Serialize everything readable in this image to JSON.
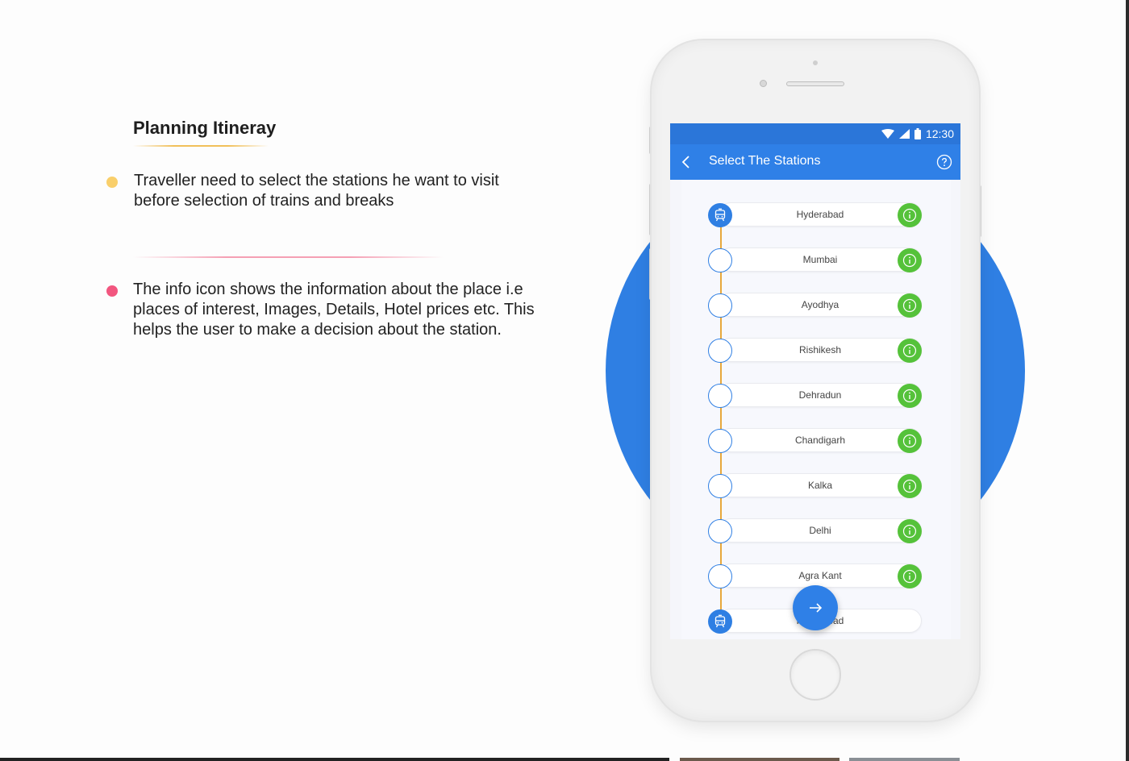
{
  "section": {
    "title": "Planning Itineray",
    "bullets": [
      {
        "text": "Traveller need to select the stations he want to visit before selection of trains and breaks",
        "color": "#f9cf6b"
      },
      {
        "text": "The info icon shows the information about the place i.e places of interest, Images, Details, Hotel prices etc. This helps the user to make a decision about the station.",
        "color": "#f2567f"
      }
    ]
  },
  "phone": {
    "status_bar": {
      "time": "12:30",
      "icons": [
        "wifi-icon",
        "signal-icon",
        "battery-icon"
      ]
    },
    "app_bar": {
      "title": "Select The Stations",
      "back_icon": "chevron-left-icon",
      "help_icon": "help-circle-icon"
    },
    "stations": [
      {
        "name": "Hyderabad",
        "node": "train-icon"
      },
      {
        "name": "Mumbai",
        "node": "empty"
      },
      {
        "name": "Ayodhya",
        "node": "empty"
      },
      {
        "name": "Rishikesh",
        "node": "empty"
      },
      {
        "name": "Dehradun",
        "node": "empty"
      },
      {
        "name": "Chandigarh",
        "node": "empty"
      },
      {
        "name": "Kalka",
        "node": "empty"
      },
      {
        "name": "Delhi",
        "node": "empty"
      },
      {
        "name": "Agra Kant",
        "node": "empty"
      },
      {
        "name": "Hyderabad",
        "node": "train-icon"
      }
    ],
    "fab_icon": "arrow-right-icon",
    "colors": {
      "primary": "#2f80e7",
      "info": "#55c23a",
      "route": "#e8a83c"
    }
  }
}
